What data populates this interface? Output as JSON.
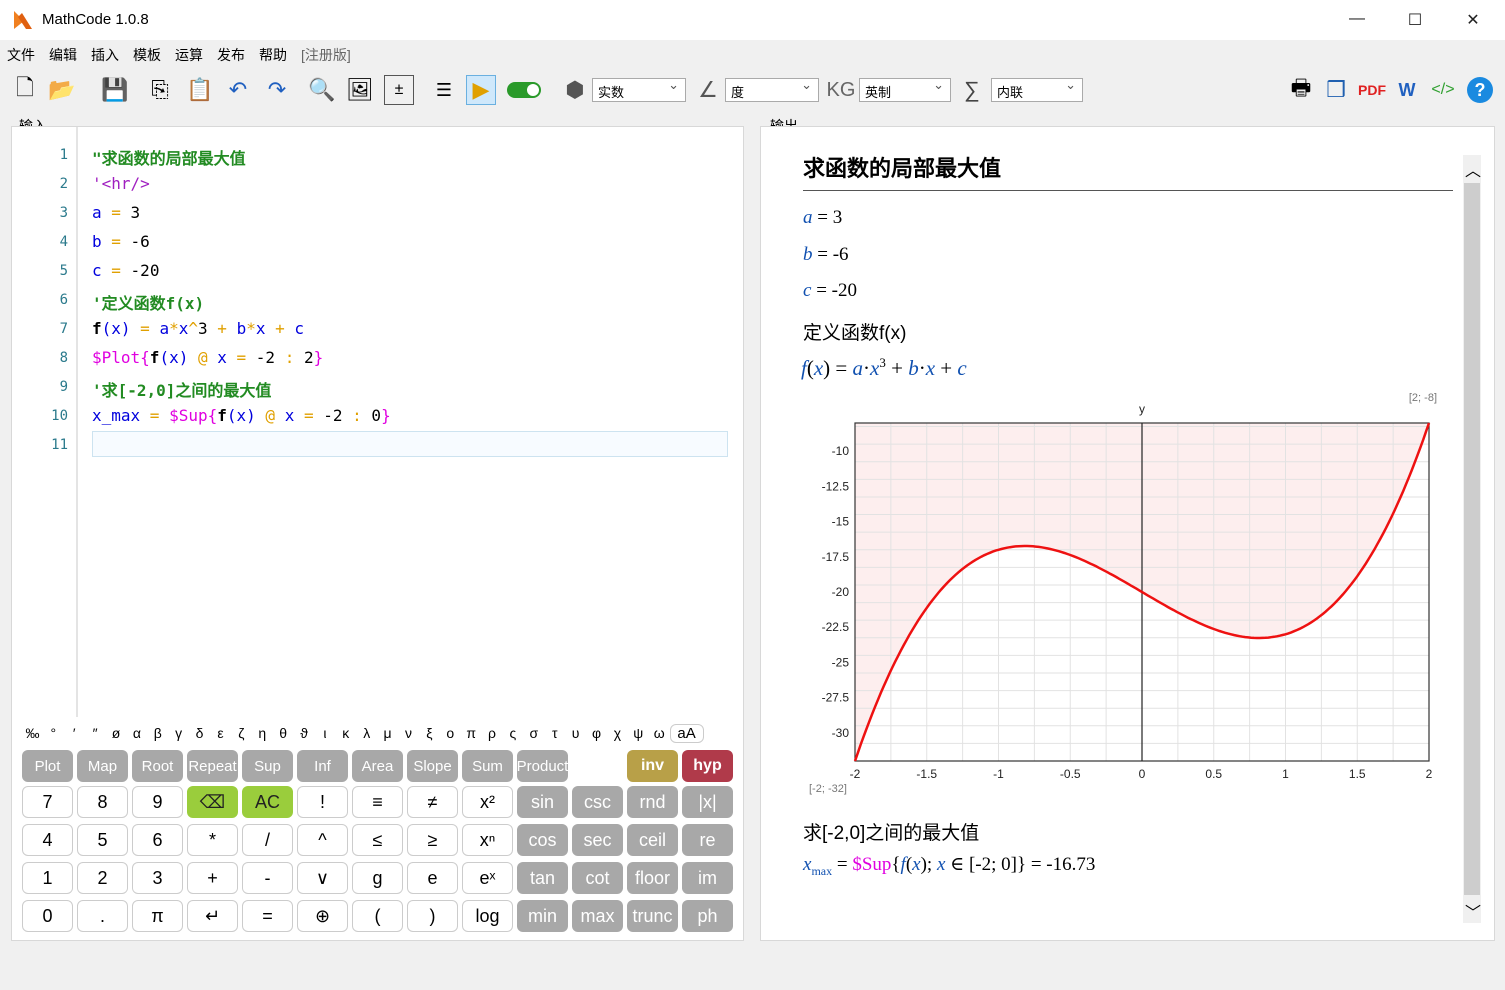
{
  "window": {
    "title": "MathCode 1.0.8"
  },
  "menu": [
    "文件",
    "编辑",
    "插入",
    "模板",
    "运算",
    "发布",
    "帮助",
    "[注册版]"
  ],
  "toolbar": {
    "number_mode": "实数",
    "angle_mode": "度",
    "unit_mode": "英制",
    "sum_mode": "内联"
  },
  "panels": {
    "input": "输入",
    "output": "输出"
  },
  "code_lines": [
    {
      "n": "1",
      "segs": [
        {
          "t": "\"求函数的局部最大值",
          "c": "green"
        }
      ]
    },
    {
      "n": "2",
      "segs": [
        {
          "t": "'<hr/>",
          "c": "purple"
        }
      ]
    },
    {
      "n": "3",
      "segs": [
        {
          "t": "a",
          "c": "blue"
        },
        {
          "t": " = ",
          "c": "orange"
        },
        {
          "t": "3",
          "c": "bk"
        }
      ]
    },
    {
      "n": "4",
      "segs": [
        {
          "t": "b",
          "c": "blue"
        },
        {
          "t": " = ",
          "c": "orange"
        },
        {
          "t": "-6",
          "c": "bk"
        }
      ]
    },
    {
      "n": "5",
      "segs": [
        {
          "t": "c",
          "c": "blue"
        },
        {
          "t": " = ",
          "c": "orange"
        },
        {
          "t": "-20",
          "c": "bk"
        }
      ]
    },
    {
      "n": "6",
      "segs": [
        {
          "t": "'定义函数f(x)",
          "c": "green"
        }
      ]
    },
    {
      "n": "7",
      "segs": [
        {
          "t": "f",
          "c": "bk"
        },
        {
          "t": "(x)",
          "c": "blue"
        },
        {
          "t": " = ",
          "c": "orange"
        },
        {
          "t": "a",
          "c": "blue"
        },
        {
          "t": "*",
          "c": "orange"
        },
        {
          "t": "x",
          "c": "blue"
        },
        {
          "t": "^",
          "c": "orange"
        },
        {
          "t": "3",
          "c": "bk"
        },
        {
          "t": " + ",
          "c": "orange"
        },
        {
          "t": "b",
          "c": "blue"
        },
        {
          "t": "*",
          "c": "orange"
        },
        {
          "t": "x",
          "c": "blue"
        },
        {
          "t": " + ",
          "c": "orange"
        },
        {
          "t": "c",
          "c": "blue"
        }
      ]
    },
    {
      "n": "8",
      "segs": [
        {
          "t": "$Plot{",
          "c": "mag"
        },
        {
          "t": "f",
          "c": "bk"
        },
        {
          "t": "(x)",
          "c": "blue"
        },
        {
          "t": " @ ",
          "c": "orange"
        },
        {
          "t": "x",
          "c": "blue"
        },
        {
          "t": " = ",
          "c": "orange"
        },
        {
          "t": "-2",
          "c": "bk"
        },
        {
          "t": " : ",
          "c": "orange"
        },
        {
          "t": "2",
          "c": "bk"
        },
        {
          "t": "}",
          "c": "mag"
        }
      ]
    },
    {
      "n": "9",
      "segs": [
        {
          "t": "'求[-2,0]之间的最大值",
          "c": "green"
        }
      ]
    },
    {
      "n": "10",
      "segs": [
        {
          "t": "x_max",
          "c": "blue"
        },
        {
          "t": " = ",
          "c": "orange"
        },
        {
          "t": "$Sup{",
          "c": "mag"
        },
        {
          "t": "f",
          "c": "bk"
        },
        {
          "t": "(x)",
          "c": "blue"
        },
        {
          "t": " @ ",
          "c": "orange"
        },
        {
          "t": "x",
          "c": "blue"
        },
        {
          "t": " = ",
          "c": "orange"
        },
        {
          "t": "-2",
          "c": "bk"
        },
        {
          "t": " : ",
          "c": "orange"
        },
        {
          "t": "0",
          "c": "bk"
        },
        {
          "t": "}",
          "c": "mag"
        }
      ]
    },
    {
      "n": "11",
      "segs": []
    }
  ],
  "greek": [
    "‰",
    "°",
    "′",
    "″",
    "ø",
    "α",
    "β",
    "γ",
    "δ",
    "ε",
    "ζ",
    "η",
    "θ",
    "ϑ",
    "ι",
    "κ",
    "λ",
    "μ",
    "ν",
    "ξ",
    "ο",
    "π",
    "ρ",
    "ς",
    "σ",
    "τ",
    "υ",
    "φ",
    "χ",
    "ψ",
    "ω",
    "aA"
  ],
  "func_keys": [
    "Plot",
    "Map",
    "Root",
    "Repeat",
    "Sup",
    "Inf",
    "Area",
    "Slope",
    "Sum",
    "Product"
  ],
  "inv": "inv",
  "hyp": "hyp",
  "num_rows": [
    [
      "7",
      "8",
      "9",
      "⌫",
      "AC",
      "!",
      "≡",
      "≠",
      "x²",
      "sin",
      "csc",
      "rnd",
      "|x|"
    ],
    [
      "4",
      "5",
      "6",
      "*",
      "/",
      "^",
      "≤",
      "≥",
      "xⁿ",
      "cos",
      "sec",
      "ceil",
      "re"
    ],
    [
      "1",
      "2",
      "3",
      "+",
      "-",
      "∨",
      "g",
      "e",
      "eˣ",
      "tan",
      "cot",
      "floor",
      "im"
    ],
    [
      "0",
      ".",
      "π",
      "↵",
      "=",
      "⊕",
      "(",
      ")",
      "log",
      "min",
      "max",
      "trunc",
      "ph"
    ]
  ],
  "output": {
    "title": "求函数的局部最大值",
    "a": "3",
    "b": "-6",
    "c": "-20",
    "comment1": "定义函数f(x)",
    "func_def": "= a·x³ + b·x + c",
    "comment2": "求[-2,0]之间的最大值",
    "result": "= -16.73"
  },
  "chart_data": {
    "type": "line",
    "x": [
      -2,
      -1.75,
      -1.5,
      -1.25,
      -1,
      -0.816,
      -0.5,
      -0.25,
      0,
      0.25,
      0.5,
      0.816,
      1,
      1.25,
      1.5,
      1.75,
      2
    ],
    "y": [
      -32,
      -25.58,
      -21.13,
      -18.36,
      -17,
      -16.73,
      -17.38,
      -18.55,
      -20,
      -21.45,
      -22.63,
      -23.27,
      -23,
      -21.64,
      -18.88,
      -14.42,
      -8
    ],
    "xlim": [
      -2,
      2
    ],
    "ylim": [
      -32,
      -8
    ],
    "xticks": [
      "-2",
      "-1.5",
      "-1",
      "-0.5",
      "0",
      "0.5",
      "1",
      "1.5",
      "2"
    ],
    "yticks": [
      "-10",
      "-12.5",
      "-15",
      "-17.5",
      "-20",
      "-22.5",
      "-25",
      "-27.5",
      "-30"
    ],
    "ylabel": "y",
    "corner_tr": "[2; -8]",
    "corner_bl": "[-2; -32]",
    "line_color": "#ee1111",
    "fill_color": "#fdeeee"
  }
}
